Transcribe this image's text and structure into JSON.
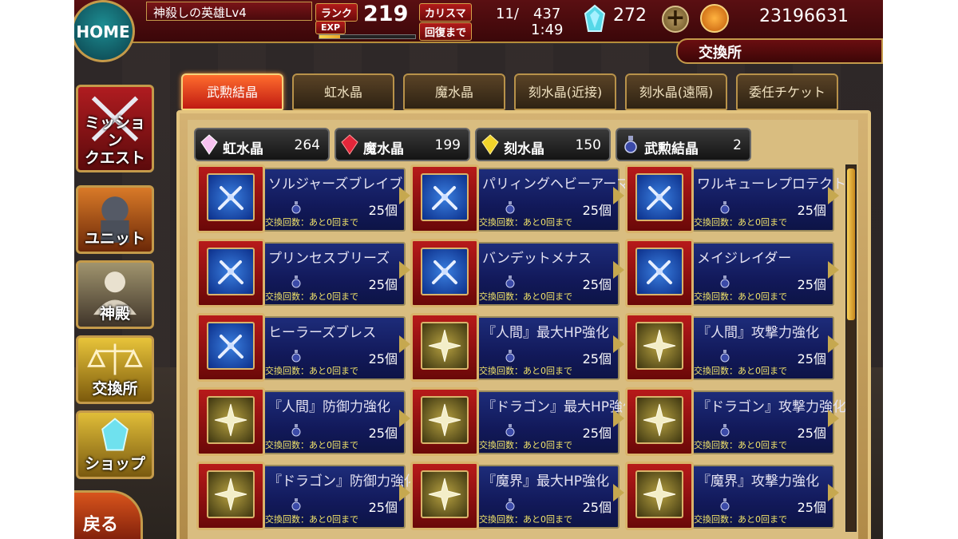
{
  "header": {
    "home_label": "HOME",
    "player_name": "神殺しの英雄Lv4",
    "rank_label": "ランク",
    "rank_value": "219",
    "exp_label": "EXP",
    "exp_progress": 0.22,
    "charisma_label": "カリスマ",
    "charisma_value": "11/　437",
    "recover_label": "回復まで",
    "recover_value": "1:49",
    "gem_value": "272",
    "coin_value": "23196631",
    "location": "交換所"
  },
  "sidebar": {
    "items": [
      {
        "label": "ミッション\nクエスト",
        "line1": "ミッション",
        "line2": "クエスト"
      },
      {
        "label": "ユニット"
      },
      {
        "label": "神殿"
      },
      {
        "label": "交換所"
      },
      {
        "label": "ショップ"
      }
    ],
    "back_label": "戻る"
  },
  "tabs": [
    "武勲結晶",
    "虹水晶",
    "魔水晶",
    "刻水晶(近接)",
    "刻水晶(遠隔)",
    "委任チケット"
  ],
  "currencies": [
    {
      "name": "虹水晶",
      "value": "264"
    },
    {
      "name": "魔水晶",
      "value": "199"
    },
    {
      "name": "刻水晶",
      "value": "150"
    },
    {
      "name": "武勲結晶",
      "value": "2"
    }
  ],
  "items": [
    {
      "name": "ソルジャーズブレイブ",
      "count": "25個",
      "limit": "交換回数：あと0回まで",
      "icon": "sword-icon"
    },
    {
      "name": "パリィングヘビーアーマー",
      "count": "25個",
      "limit": "交換回数：あと0回まで",
      "icon": "sword-icon"
    },
    {
      "name": "ワルキューレプロテクト",
      "count": "25個",
      "limit": "交換回数：あと0回まで",
      "icon": "sword-icon"
    },
    {
      "name": "プリンセスブリーズ",
      "count": "25個",
      "limit": "交換回数：あと0回まで",
      "icon": "sword-icon"
    },
    {
      "name": "バンデットメナス",
      "count": "25個",
      "limit": "交換回数：あと0回まで",
      "icon": "sword-icon"
    },
    {
      "name": "メイジレイダー",
      "count": "25個",
      "limit": "交換回数：あと0回まで",
      "icon": "sword-icon"
    },
    {
      "name": "ヒーラーズブレス",
      "count": "25個",
      "limit": "交換回数：あと0回まで",
      "icon": "sword-icon"
    },
    {
      "name": "『人間』最大HP強化",
      "count": "25個",
      "limit": "交換回数：あと0回まで",
      "icon": "star-icon"
    },
    {
      "name": "『人間』攻撃力強化",
      "count": "25個",
      "limit": "交換回数：あと0回まで",
      "icon": "star-icon"
    },
    {
      "name": "『人間』防御力強化",
      "count": "25個",
      "limit": "交換回数：あと0回まで",
      "icon": "star-icon"
    },
    {
      "name": "『ドラゴン』最大HP強化",
      "count": "25個",
      "limit": "交換回数：あと0回まで",
      "icon": "star-icon"
    },
    {
      "name": "『ドラゴン』攻撃力強化",
      "count": "25個",
      "limit": "交換回数：あと0回まで",
      "icon": "star-icon"
    },
    {
      "name": "『ドラゴン』防御力強化",
      "count": "25個",
      "limit": "交換回数：あと0回まで",
      "icon": "star-icon"
    },
    {
      "name": "『魔界』最大HP強化",
      "count": "25個",
      "limit": "交換回数：あと0回まで",
      "icon": "star-icon"
    },
    {
      "name": "『魔界』攻撃力強化",
      "count": "25個",
      "limit": "交換回数：あと0回まで",
      "icon": "star-icon"
    }
  ]
}
